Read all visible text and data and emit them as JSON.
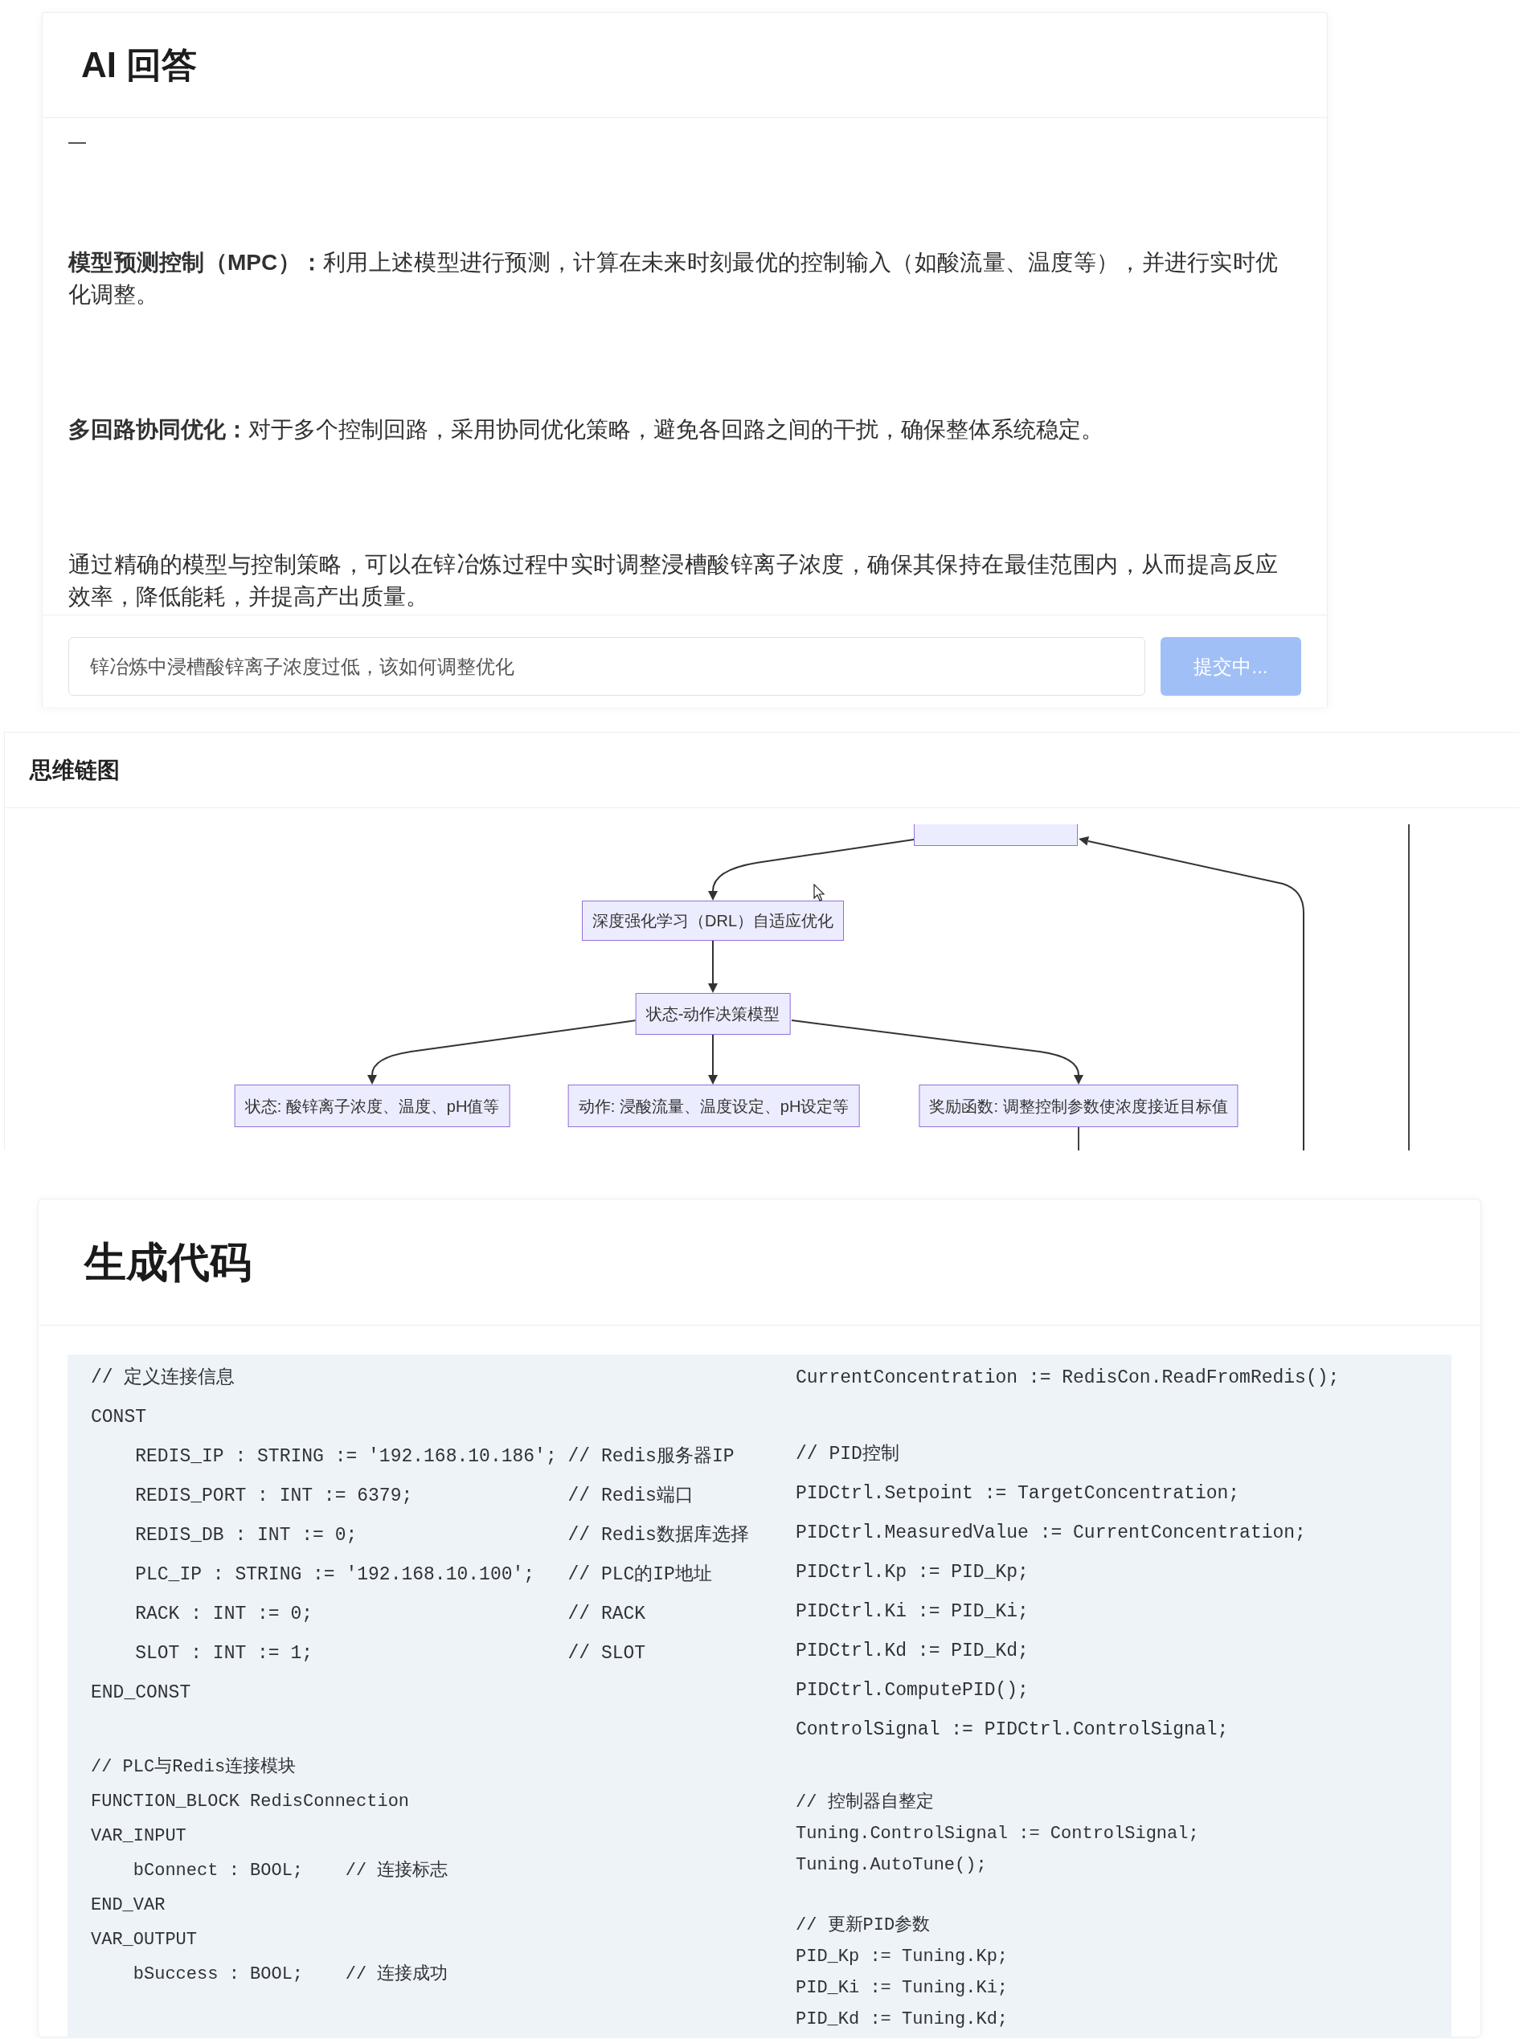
{
  "answer_panel": {
    "title": "AI 回答",
    "paragraphs": [
      "**模型预测控制（MPC）：**利用上述模型进行预测，计算在未来时刻最优的控制输入（如酸流量、温度等），并进行实时优化调整。",
      "**多回路协同优化：**对于多个控制回路，采用协同优化策略，避免各回路之间的干扰，确保整体系统稳定。",
      "通过精确的模型与控制策略，可以在锌冶炼过程中实时调整浸槽酸锌离子浓度，确保其保持在最佳范围内，从而提高反应效率，降低能耗，并提高产出质量。"
    ],
    "question": {
      "value": "锌冶炼中浸槽酸锌离子浓度过低，该如何调整优化"
    },
    "submit_button": {
      "label": "提交中...",
      "disabled": true
    }
  },
  "mind_map_panel": {
    "title": "思维链图",
    "nodes": [
      {
        "label": "深度强化学习（DRL）自适应优化"
      },
      {
        "label": "状态-动作决策模型"
      },
      {
        "label": "状态: 酸锌离子浓度、温度、pH值等"
      },
      {
        "label": "动作: 浸酸流量、温度设定、pH设定等"
      },
      {
        "label": "奖励函数: 调整控制参数使浓度接近目标值"
      }
    ]
  },
  "code_panel": {
    "title": "生成代码",
    "columns": [
      {
        "blocks": [
          {
            "kind": "wide",
            "lines": [
              "// 定义连接信息",
              "CONST",
              "    REDIS_IP : STRING := '192.168.10.186'; // Redis服务器IP",
              "    REDIS_PORT : INT := 6379;              // Redis端口",
              "    REDIS_DB : INT := 0;                   // Redis数据库选择",
              "    PLC_IP : STRING := '192.168.10.100';   // PLC的IP地址",
              "    RACK : INT := 0;                       // RACK",
              "    SLOT : INT := 1;                       // SLOT",
              "END_CONST"
            ]
          },
          {
            "kind": "medium",
            "lines": [
              "// PLC与Redis连接模块",
              "FUNCTION_BLOCK RedisConnection",
              "VAR_INPUT",
              "    bConnect : BOOL;    // 连接标志",
              "END_VAR",
              "VAR_OUTPUT",
              "    bSuccess : BOOL;    // 连接成功"
            ]
          }
        ]
      },
      {
        "blocks": [
          {
            "kind": "wide",
            "lines": [
              "CurrentConcentration := RedisCon.ReadFromRedis();"
            ]
          },
          {
            "kind": "wide",
            "lines": [
              "// PID控制",
              "PIDCtrl.Setpoint := TargetConcentration;",
              "PIDCtrl.MeasuredValue := CurrentConcentration;",
              "PIDCtrl.Kp := PID_Kp;",
              "PIDCtrl.Ki := PID_Ki;",
              "PIDCtrl.Kd := PID_Kd;",
              "PIDCtrl.ComputePID();",
              "ControlSignal := PIDCtrl.ControlSignal;"
            ]
          },
          {
            "kind": "narrow",
            "lines": [
              "// 控制器自整定",
              "Tuning.ControlSignal := ControlSignal;",
              "Tuning.AutoTune();"
            ]
          },
          {
            "kind": "narrow",
            "lines": [
              "// 更新PID参数",
              "PID_Kp := Tuning.Kp;",
              "PID_Ki := Tuning.Ki;",
              "PID_Kd := Tuning.Kd;"
            ]
          }
        ]
      }
    ]
  }
}
